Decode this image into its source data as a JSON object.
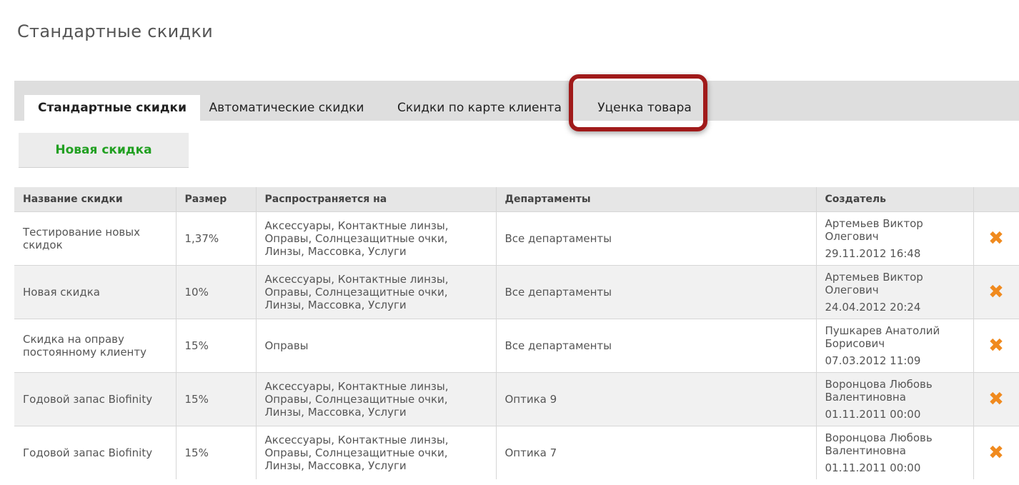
{
  "page": {
    "title": "Стандартные скидки"
  },
  "tabs": [
    {
      "label": "Стандартные скидки"
    },
    {
      "label": "Автоматические скидки"
    },
    {
      "label": "Скидки по карте клиента"
    },
    {
      "label": "Уценка товара"
    }
  ],
  "new_button": {
    "label": "Новая скидка"
  },
  "table": {
    "headers": [
      "Название скидки",
      "Размер",
      "Распространяется на",
      "Департаменты",
      "Создатель"
    ],
    "rows": [
      {
        "name": "Тестирование новых скидок",
        "size": "1,37%",
        "applies_to": "Аксессуары, Контактные линзы, Оправы, Солнцезащитные очки, Линзы, Массовка, Услуги",
        "departments": "Все департаменты",
        "creator": "Артемьев Виктор Олегович",
        "date": "29.11.2012 16:48"
      },
      {
        "name": "Новая скидка",
        "size": "10%",
        "applies_to": "Аксессуары, Контактные линзы, Оправы, Солнцезащитные очки, Линзы, Массовка, Услуги",
        "departments": "Все департаменты",
        "creator": "Артемьев Виктор Олегович",
        "date": "24.04.2012 20:24"
      },
      {
        "name": "Скидка на оправу постоянному клиенту",
        "size": "15%",
        "applies_to": "Оправы",
        "departments": "Все департаменты",
        "creator": "Пушкарев Анатолий Борисович",
        "date": "07.03.2012 11:09"
      },
      {
        "name": "Годовой запас Biofinity",
        "size": "15%",
        "applies_to": "Аксессуары, Контактные линзы, Оправы, Солнцезащитные очки, Линзы, Массовка, Услуги",
        "departments": "Оптика 9",
        "creator": "Воронцова Любовь Валентиновна",
        "date": "01.11.2011 00:00"
      },
      {
        "name": "Годовой запас Biofinity",
        "size": "15%",
        "applies_to": "Аксессуары, Контактные линзы, Оправы, Солнцезащитные очки, Линзы, Массовка, Услуги",
        "departments": "Оптика 7",
        "creator": "Воронцова Любовь Валентиновна",
        "date": "01.11.2011 00:00"
      }
    ],
    "delete_icon": "delete-x-icon"
  },
  "colors": {
    "accent_green": "#22a022",
    "highlight_red": "#a01a1a",
    "delete_orange": "#f08a1e"
  }
}
